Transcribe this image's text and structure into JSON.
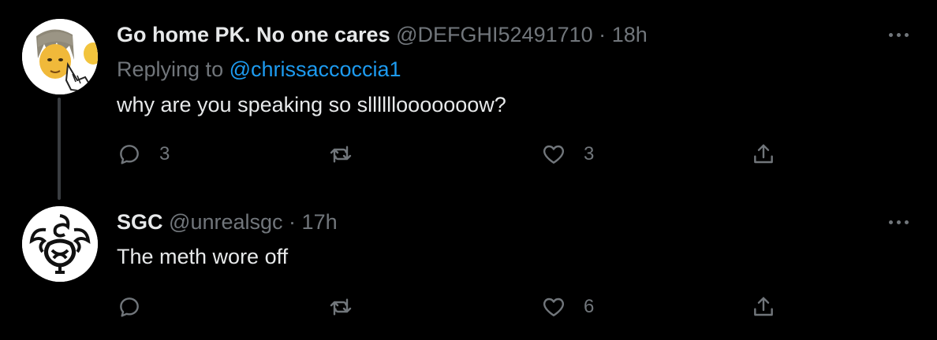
{
  "tweets": [
    {
      "name": "Go home PK. No one cares",
      "handle": "@DEFGHI52491710",
      "separator": "·",
      "time": "18h",
      "replying_prefix": "Replying to ",
      "replying_to": "@chrissaccoccia1",
      "text": "why are you speaking so sllllllooooooow?",
      "replies": "3",
      "retweets": "",
      "likes": "3",
      "avatar_icon": "cartoon-face-avatar"
    },
    {
      "name": "SGC",
      "handle": "@unrealsgc",
      "separator": "·",
      "time": "17h",
      "text": "The meth wore off",
      "replies": "",
      "retweets": "",
      "likes": "6",
      "avatar_icon": "dragon-knot-avatar"
    }
  ],
  "colors": {
    "background": "#000000",
    "text": "#e7e9ea",
    "muted": "#71767b",
    "link": "#1d9bf0",
    "thread_line": "#3a3d41"
  }
}
